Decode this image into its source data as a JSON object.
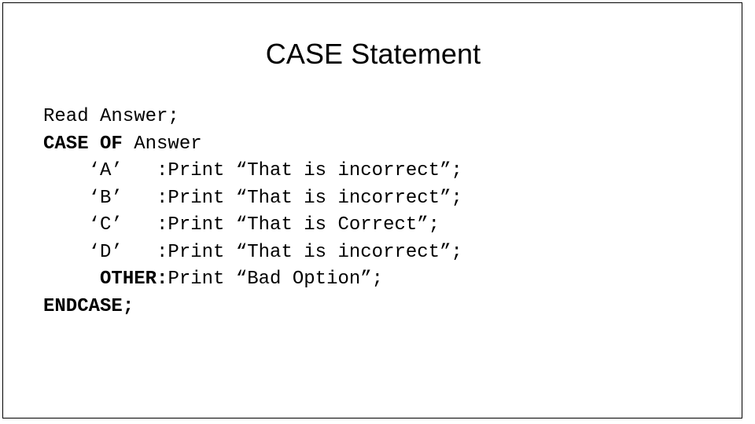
{
  "slide": {
    "title": "CASE Statement",
    "background_color": "#ffffff",
    "border_color": "#000000",
    "text_color": "#000000"
  },
  "code": {
    "lines": [
      {
        "id": "read-statement",
        "segments": [
          {
            "text": "Read Answer;",
            "bold": false
          }
        ]
      },
      {
        "id": "case-of-statement",
        "segments": [
          {
            "text": "CASE OF ",
            "bold": true
          },
          {
            "text": "Answer",
            "bold": false
          }
        ]
      },
      {
        "id": "branch-a",
        "segments": [
          {
            "text": "    ‘A’   :Print “That is incorrect”;",
            "bold": false
          }
        ]
      },
      {
        "id": "branch-b",
        "segments": [
          {
            "text": "    ‘B’   :Print “That is incorrect”;",
            "bold": false
          }
        ]
      },
      {
        "id": "branch-c",
        "segments": [
          {
            "text": "    ‘C’   :Print “That is Correct”;",
            "bold": false
          }
        ]
      },
      {
        "id": "branch-d",
        "segments": [
          {
            "text": "    ‘D’   :Print “That is incorrect”;",
            "bold": false
          }
        ]
      },
      {
        "id": "branch-other",
        "segments": [
          {
            "text": "     OTHER:",
            "bold": true
          },
          {
            "text": "Print “Bad Option”;",
            "bold": false
          }
        ]
      },
      {
        "id": "endcase-statement",
        "segments": [
          {
            "text": "ENDCASE;",
            "bold": true
          }
        ]
      }
    ]
  }
}
